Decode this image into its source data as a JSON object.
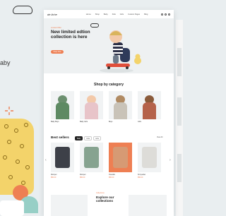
{
  "backdrop": {
    "tagline": "aby"
  },
  "nav": {
    "logo": "de liche",
    "items": [
      "Home",
      "Shop",
      "Baby",
      "Kids",
      "Girls",
      "Custom Pages",
      "Blog"
    ]
  },
  "hero": {
    "label": "Limited Offer",
    "title": "New limited edtion collection is here",
    "button": "Shop Now"
  },
  "categories": {
    "title": "Shop by category",
    "items": [
      {
        "label": "Baby Boys"
      },
      {
        "label": "Baby Girls"
      },
      {
        "label": "Boys"
      },
      {
        "label": "Girls"
      }
    ]
  },
  "best_sellers": {
    "title": "Best sellers",
    "tabs": [
      "Baby",
      "Kids",
      "Girls"
    ],
    "view_all": "View All",
    "products": [
      {
        "name": "Romper",
        "price": "$50.00",
        "color": "#3d4048"
      },
      {
        "name": "Romper",
        "price": "$50.00",
        "color": "#86a390"
      },
      {
        "name": "Overalls",
        "price": "$50.00",
        "color": "#d69a74"
      },
      {
        "name": "Knit jacket",
        "price": "$50.00",
        "color": "#dddcd8"
      }
    ]
  },
  "explore": {
    "label": "Collections",
    "title": "Explore our collections"
  },
  "colors": {
    "accent": "#ee7f53",
    "yellow": "#f3d36a",
    "teal": "#97cfc6"
  }
}
